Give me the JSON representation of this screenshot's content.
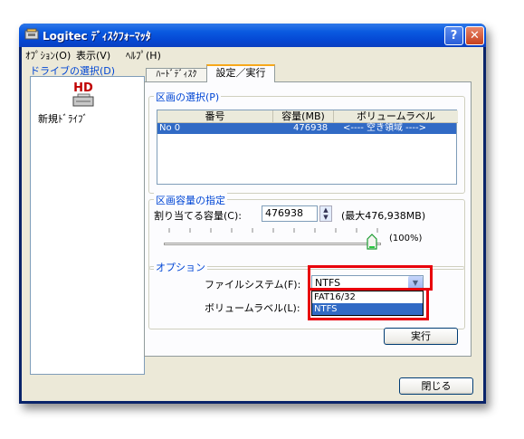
{
  "window": {
    "title": "Logitec ﾃﾞｨｽｸﾌｫｰﾏｯﾀ"
  },
  "menu": [
    "ｵﾌﾟｼｮﾝ(O)",
    "表示(V)",
    "ﾍﾙﾌﾟ(H)"
  ],
  "drive_panel": {
    "label": "ドライブの選択(D)",
    "items": [
      {
        "icon": "hd-icon",
        "icon_text": "HD",
        "label": "新規ﾄﾞﾗｲﾌﾞ"
      }
    ]
  },
  "tabs": [
    "ﾊｰﾄﾞﾃﾞｨｽｸ",
    "設定／実行"
  ],
  "partition": {
    "label": "区画の選択(P)",
    "columns": [
      "番号",
      "容量(MB)",
      "ボリュームラベル"
    ],
    "rows": [
      {
        "number": "No 0",
        "capacity": "476938",
        "volume": "<---- 空き領域 ---->"
      }
    ]
  },
  "capacity": {
    "label": "区画容量の指定",
    "field_label": "割り当てる容量(C):",
    "value": "476938",
    "max": "(最大476,938MB)",
    "percent": "(100%)",
    "slider_level": 1.0
  },
  "options": {
    "label": "オプション",
    "fs_label": "ファイルシステム(F):",
    "fs_value": "NTFS",
    "fs_options": [
      "FAT16/32",
      "NTFS"
    ],
    "volume_label": "ボリュームラベル(L):"
  },
  "buttons": {
    "execute": "実行",
    "close": "閉じる"
  },
  "colors": {
    "titlebar": "#0a5ae0",
    "selection": "#316ac5",
    "highlight": "#e8000b",
    "group_label": "#0046d5"
  }
}
